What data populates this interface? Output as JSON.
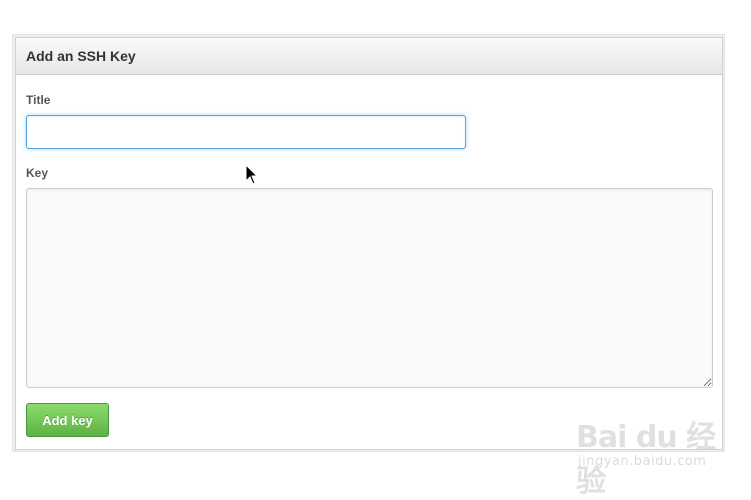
{
  "panel": {
    "title": "Add an SSH Key"
  },
  "form": {
    "title_label": "Title",
    "title_value": "",
    "key_label": "Key",
    "key_value": "",
    "submit_label": "Add key"
  },
  "watermark": {
    "logo_text": "Bai du 经验",
    "url": "jingyan.baidu.com"
  },
  "icons": {
    "cursor": "mouse-pointer-icon"
  },
  "colors": {
    "button_green": "#60b044",
    "focus_blue": "#51a7e8"
  }
}
